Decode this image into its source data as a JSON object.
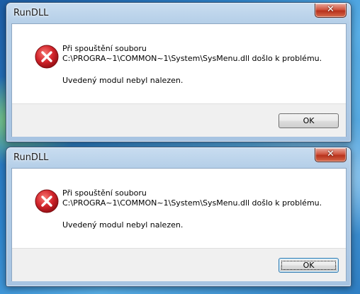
{
  "dialogs": [
    {
      "title": "RunDLL",
      "close_label": "✕",
      "icon": "error-icon",
      "message_line1": "Při spouštění souboru",
      "message_line2": "C:\\PROGRA~1\\COMMON~1\\System\\SysMenu.dll došlo k problému.",
      "message_line3": "Uvedený modul nebyl nalezen.",
      "ok_label": "OK"
    },
    {
      "title": "RunDLL",
      "close_label": "✕",
      "icon": "error-icon",
      "message_line1": "Při spouštění souboru",
      "message_line2": "C:\\PROGRA~1\\COMMON~1\\System\\SysMenu.dll došlo k problému.",
      "message_line3": "Uvedený modul nebyl nalezen.",
      "ok_label": "OK"
    }
  ],
  "colors": {
    "error_red": "#d2242b",
    "close_button": "#c8402a",
    "button_bar": "#f0f0f0"
  }
}
